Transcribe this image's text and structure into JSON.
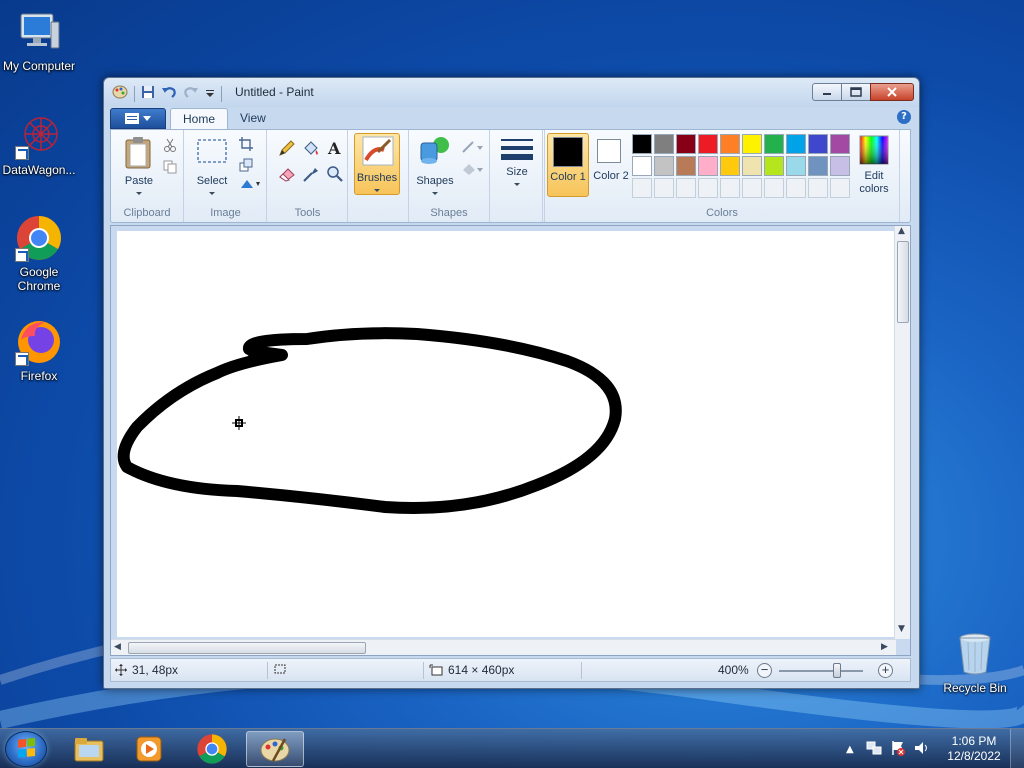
{
  "desktop": {
    "icons": [
      {
        "label": "My Computer"
      },
      {
        "label": "DataWagon..."
      },
      {
        "label": "Google Chrome"
      },
      {
        "label": "Firefox"
      },
      {
        "label": "Recycle Bin"
      }
    ]
  },
  "window": {
    "title": "Untitled - Paint"
  },
  "ribbon": {
    "tabs": [
      {
        "label": "Home",
        "active": true
      },
      {
        "label": "View",
        "active": false
      }
    ],
    "groups": {
      "clipboard": {
        "label": "Clipboard",
        "paste": "Paste"
      },
      "image": {
        "label": "Image",
        "select": "Select"
      },
      "tools": {
        "label": "Tools"
      },
      "brushes": {
        "label": "Brushes"
      },
      "shapes": {
        "label": "Shapes",
        "shapes": "Shapes"
      },
      "size": {
        "label": "Size"
      },
      "colors": {
        "label": "Colors",
        "color1": "Color 1",
        "color2": "Color 2",
        "edit": "Edit colors",
        "color1_value": "#000000",
        "color2_value": "#ffffff",
        "palette": [
          "#000000",
          "#7f7f7f",
          "#880015",
          "#ed1c24",
          "#ff7f27",
          "#fff200",
          "#22b14c",
          "#00a2e8",
          "#3f48cc",
          "#a349a4",
          "#ffffff",
          "#c3c3c3",
          "#b97a57",
          "#ffaec9",
          "#ffc90e",
          "#efe4b0",
          "#b5e61d",
          "#99d9ea",
          "#7092be",
          "#c8bfe7"
        ]
      }
    }
  },
  "status": {
    "cursor_pos": "31, 48px",
    "image_size": "614 × 460px",
    "zoom": "400%"
  },
  "taskbar": {
    "time": "1:06 PM",
    "date": "12/8/2022"
  }
}
